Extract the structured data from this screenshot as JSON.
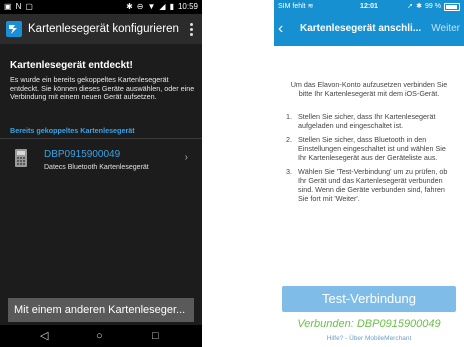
{
  "android": {
    "status": {
      "time": "10:59"
    },
    "appbar": {
      "title": "Kartenlesegerät konfigurieren"
    },
    "heading": "Kartenlesegerät entdeckt!",
    "description": "Es wurde ein bereits gekoppeltes Kartenlesegerät entdeckt. Sie können dieses Geräte auswählen, oder eine Verbindung mit einem neuen Gerät aufsetzen.",
    "section_label": "Bereits gekoppeltes Kartenlesegerät",
    "device": {
      "name": "DBP0915900049",
      "subtitle": "Datecs Bluetooth Kartenlesegerät"
    },
    "bottom_button": "Mit einem anderen Kartenleseger...",
    "nav": {
      "back": "◁",
      "home": "○",
      "recent": "□"
    }
  },
  "ios": {
    "status": {
      "carrier": "SIM fehlt",
      "time": "12:01",
      "battery": "99 %"
    },
    "nav": {
      "title": "Kartenlesegerät anschli...",
      "next": "Weiter"
    },
    "intro": "Um das Elavon-Konto aufzusetzen verbinden Sie bitte Ihr Kartenlesegerät mit dem iOS-Gerät.",
    "steps": [
      {
        "num": "1.",
        "text": "Stellen Sie sicher, dass Ihr Kartenlesegerät aufgeladen und eingeschaltet ist."
      },
      {
        "num": "2.",
        "text": "Stellen Sie sicher, dass Bluetooth in den Einstellungen eingeschaltet ist und wählen Sie Ihr Kartenlesegerät aus der Geräteliste aus."
      },
      {
        "num": "3.",
        "text": "Wählen Sie 'Test-Verbindung' um zu prüfen, ob Ihr Gerät und das Kartenlesegerät verbunden sind. Wenn die Geräte verbunden sind, fahren Sie fort mit 'Weiter'."
      }
    ],
    "test_button": "Test-Verbindung",
    "connected": "Verbunden: DBP0915900049",
    "help": "Hilfe? - Über MobileMerchant"
  },
  "colors": {
    "android_accent": "#3aa3e6",
    "ios_header": "#1690d0",
    "ios_button": "#7fbde8",
    "success": "#6bc04a"
  }
}
